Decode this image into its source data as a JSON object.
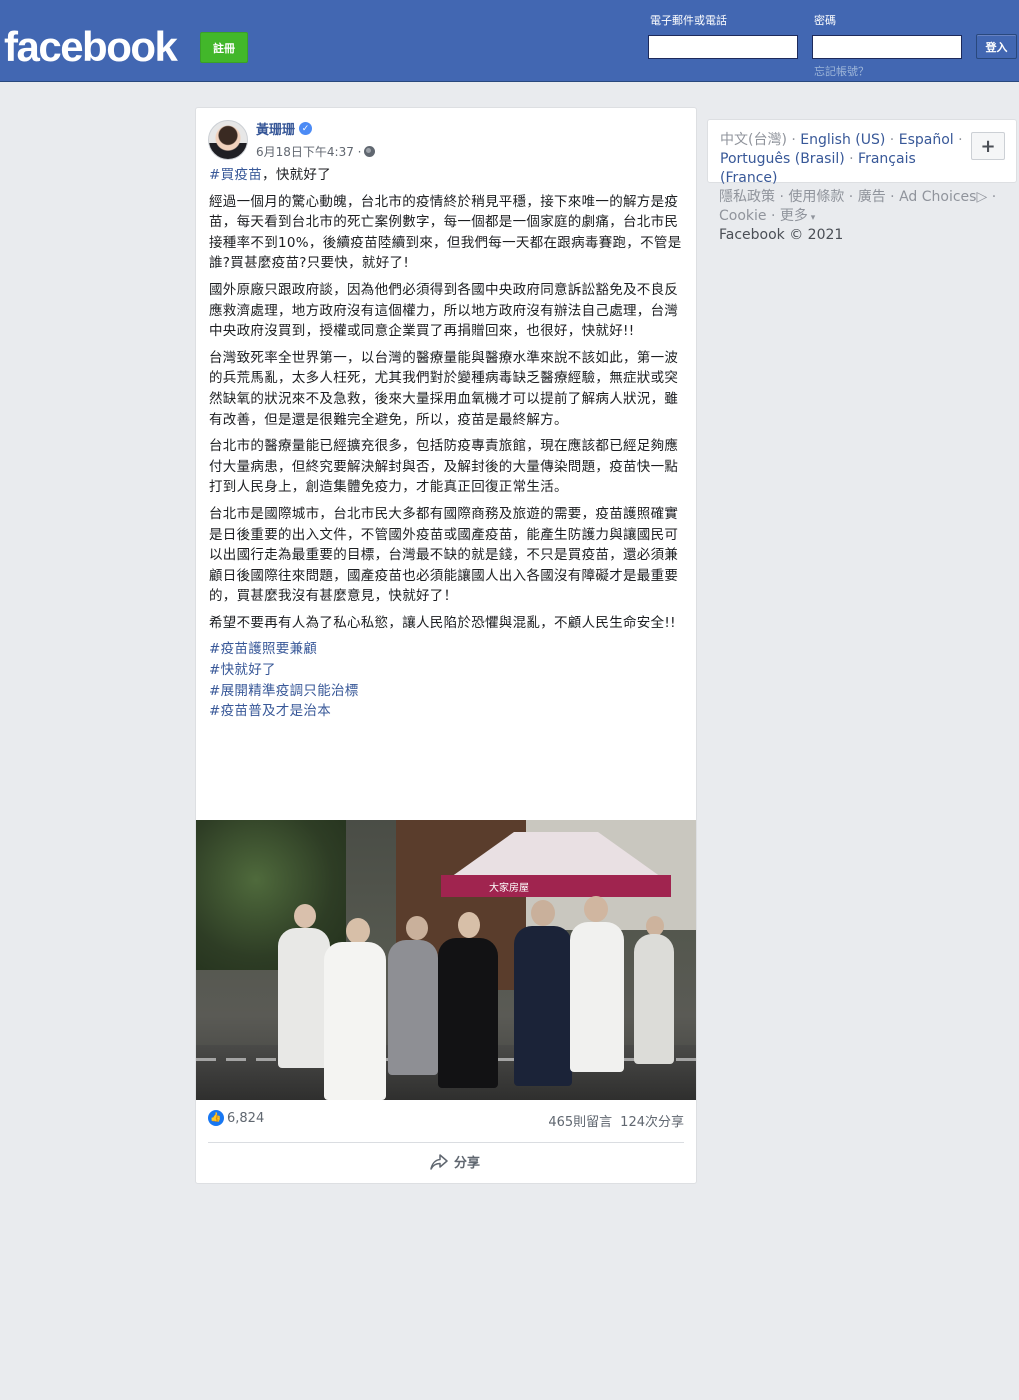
{
  "header": {
    "logo": "facebook",
    "signup_label": "註冊",
    "email_label": "電子郵件或電話",
    "password_label": "密碼",
    "login_label": "登入",
    "forgot_label": "忘記帳號？"
  },
  "post": {
    "author": "黃珊珊",
    "timestamp": "6月18日下午4:37 ·",
    "first_line_tag": "#買疫苗",
    "first_line_rest": "，快就好了",
    "paragraphs": [
      "經過一個月的驚心動魄，台北市的疫情終於稍見平穩，接下來唯一的解方是疫苗，每天看到台北市的死亡案例數字，每一個都是一個家庭的劇痛，台北市民接種率不到10%，後續疫苗陸續到來，但我們每一天都在跟病毒賽跑，不管是誰?買甚麼疫苗?只要快，就好了!",
      "國外原廠只跟政府談，因為他們必須得到各國中央政府同意訴訟豁免及不良反應救濟處理，地方政府沒有這個權力，所以地方政府沒有辦法自己處理，台灣中央政府沒買到，授權或同意企業買了再捐贈回來，也很好，快就好!!",
      "台灣致死率全世界第一，以台灣的醫療量能與醫療水準來說不該如此，第一波的兵荒馬亂，太多人枉死，尤其我們對於變種病毒缺乏醫療經驗，無症狀或突然缺氧的狀況來不及急救，後來大量採用血氧機才可以提前了解病人狀況，雖有改善，但是還是很難完全避免，所以，疫苗是最終解方。",
      "台北市的醫療量能已經擴充很多，包括防疫專責旅館，現在應該都已經足夠應付大量病患，但終究要解決解封與否，及解封後的大量傳染問題，疫苗快一點打到人民身上，創造集體免疫力，才能真正回復正常生活。",
      "台北市是國際城市，台北市民大多都有國際商務及旅遊的需要，疫苗護照確實是日後重要的出入文件，不管國外疫苗或國產疫苗，能產生防護力與讓國民可以出國行走為最重要的目標，台灣最不缺的就是錢，不只是買疫苗，還必須兼顧日後國際往來問題，國產疫苗也必須能讓國人出入各國沒有障礙才是最重要的，買甚麼我沒有甚麼意見，快就好了！",
      "希望不要再有人為了私心私慾，讓人民陷於恐懼與混亂，不顧人民生命安全!!"
    ],
    "hashtags": [
      "#疫苗護照要兼顧",
      "#快就好了",
      "#展開精準疫調只能治標",
      "#疫苗普及才是治本"
    ],
    "photo_sign_text": "大家房屋",
    "likes": "6,824",
    "comments": "465則留言",
    "shares": "124次分享",
    "share_label": "分享"
  },
  "sidebar": {
    "languages": [
      "中文(台灣)",
      "English (US)",
      "Español",
      "Português (Brasil)",
      "Français (France)"
    ],
    "plus_label": "+",
    "links": [
      "隱私政策",
      "使用條款",
      "廣告",
      "Ad Choices",
      "Cookie",
      "更多"
    ],
    "copyright": "Facebook © 2021"
  },
  "colors": {
    "header_bg": "#4267b2",
    "signup_green": "#42b72a",
    "link_blue": "#385898",
    "page_bg": "#e9ebee"
  }
}
